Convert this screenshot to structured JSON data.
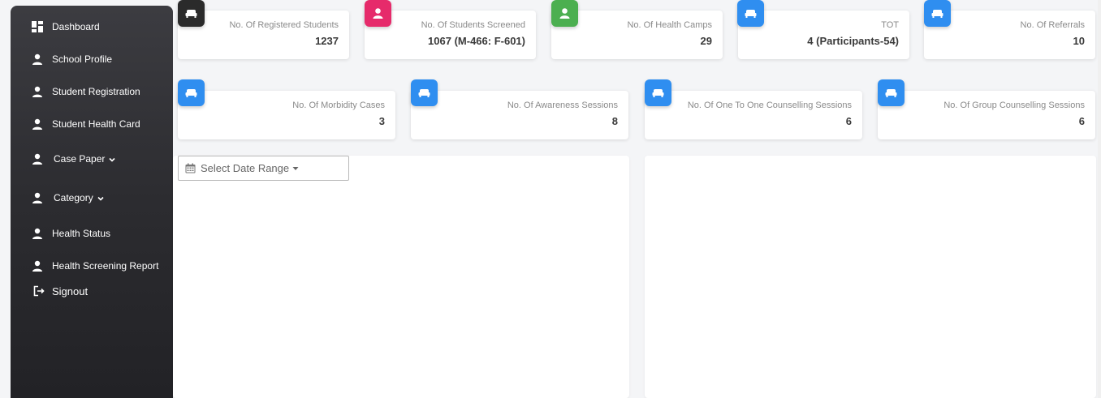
{
  "sidebar": {
    "items": [
      {
        "label": "Dashboard",
        "icon": "dashboard-icon"
      },
      {
        "label": "School Profile",
        "icon": "user-icon"
      },
      {
        "label": "Student Registration",
        "icon": "user-icon"
      },
      {
        "label": "Student Health Card",
        "icon": "user-icon"
      },
      {
        "label": "Case Paper",
        "icon": "user-icon",
        "has_dropdown": true
      },
      {
        "label": "Category",
        "icon": "user-icon",
        "has_dropdown": true
      },
      {
        "label": "Health Status",
        "icon": "user-icon"
      },
      {
        "label": "Health Screening Report",
        "icon": "user-icon"
      },
      {
        "label": "Signout",
        "icon": "signout-icon"
      }
    ]
  },
  "stats_row1": [
    {
      "label": "No. Of Registered Students",
      "value": "1237",
      "icon": "sofa-icon",
      "color": "#2b2b2b"
    },
    {
      "label": "No. Of Students Screened",
      "value": "1067 (M-466: F-601)",
      "icon": "user-icon",
      "color": "#e62b6b"
    },
    {
      "label": "No. Of Health Camps",
      "value": "29",
      "icon": "user-icon",
      "color": "#4caf50"
    },
    {
      "label": "TOT",
      "value": "4 (Participants-54)",
      "icon": "sofa-icon",
      "color": "#2f8ef0"
    },
    {
      "label": "No. Of Referrals",
      "value": "10",
      "icon": "sofa-icon",
      "color": "#2f8ef0"
    }
  ],
  "stats_row2": [
    {
      "label": "No. Of Morbidity Cases",
      "value": "3",
      "icon": "sofa-icon",
      "color": "#2f8ef0"
    },
    {
      "label": "No. Of Awareness Sessions",
      "value": "8",
      "icon": "sofa-icon",
      "color": "#2f8ef0"
    },
    {
      "label": "No. Of One To One Counselling Sessions",
      "value": "6",
      "icon": "sofa-icon",
      "color": "#2f8ef0"
    },
    {
      "label": "No. Of Group Counselling Sessions",
      "value": "6",
      "icon": "sofa-icon",
      "color": "#2f8ef0"
    }
  ],
  "date_range": {
    "label": "Select Date Range",
    "icon": "calendar-icon"
  }
}
